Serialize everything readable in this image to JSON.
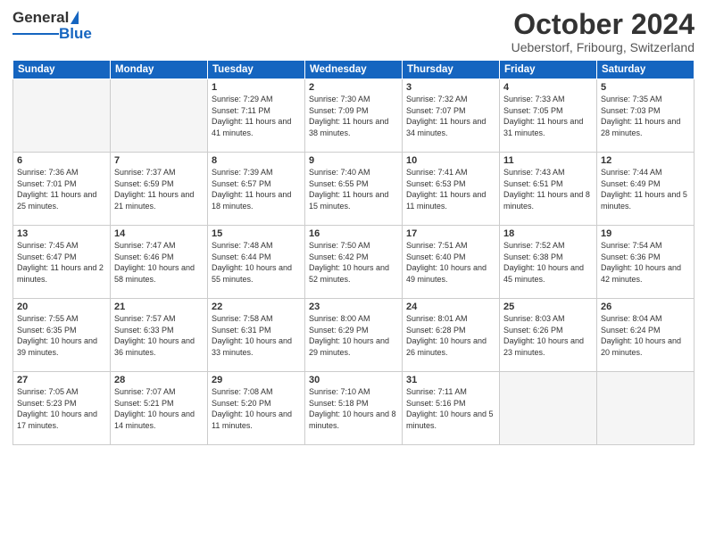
{
  "header": {
    "logo_general": "General",
    "logo_blue": "Blue",
    "main_title": "October 2024",
    "subtitle": "Ueberstorf, Fribourg, Switzerland"
  },
  "weekdays": [
    "Sunday",
    "Monday",
    "Tuesday",
    "Wednesday",
    "Thursday",
    "Friday",
    "Saturday"
  ],
  "weeks": [
    [
      {
        "day": "",
        "sunrise": "",
        "sunset": "",
        "daylight": "",
        "empty": true
      },
      {
        "day": "",
        "sunrise": "",
        "sunset": "",
        "daylight": "",
        "empty": true
      },
      {
        "day": "1",
        "sunrise": "Sunrise: 7:29 AM",
        "sunset": "Sunset: 7:11 PM",
        "daylight": "Daylight: 11 hours and 41 minutes.",
        "empty": false
      },
      {
        "day": "2",
        "sunrise": "Sunrise: 7:30 AM",
        "sunset": "Sunset: 7:09 PM",
        "daylight": "Daylight: 11 hours and 38 minutes.",
        "empty": false
      },
      {
        "day": "3",
        "sunrise": "Sunrise: 7:32 AM",
        "sunset": "Sunset: 7:07 PM",
        "daylight": "Daylight: 11 hours and 34 minutes.",
        "empty": false
      },
      {
        "day": "4",
        "sunrise": "Sunrise: 7:33 AM",
        "sunset": "Sunset: 7:05 PM",
        "daylight": "Daylight: 11 hours and 31 minutes.",
        "empty": false
      },
      {
        "day": "5",
        "sunrise": "Sunrise: 7:35 AM",
        "sunset": "Sunset: 7:03 PM",
        "daylight": "Daylight: 11 hours and 28 minutes.",
        "empty": false
      }
    ],
    [
      {
        "day": "6",
        "sunrise": "Sunrise: 7:36 AM",
        "sunset": "Sunset: 7:01 PM",
        "daylight": "Daylight: 11 hours and 25 minutes.",
        "empty": false
      },
      {
        "day": "7",
        "sunrise": "Sunrise: 7:37 AM",
        "sunset": "Sunset: 6:59 PM",
        "daylight": "Daylight: 11 hours and 21 minutes.",
        "empty": false
      },
      {
        "day": "8",
        "sunrise": "Sunrise: 7:39 AM",
        "sunset": "Sunset: 6:57 PM",
        "daylight": "Daylight: 11 hours and 18 minutes.",
        "empty": false
      },
      {
        "day": "9",
        "sunrise": "Sunrise: 7:40 AM",
        "sunset": "Sunset: 6:55 PM",
        "daylight": "Daylight: 11 hours and 15 minutes.",
        "empty": false
      },
      {
        "day": "10",
        "sunrise": "Sunrise: 7:41 AM",
        "sunset": "Sunset: 6:53 PM",
        "daylight": "Daylight: 11 hours and 11 minutes.",
        "empty": false
      },
      {
        "day": "11",
        "sunrise": "Sunrise: 7:43 AM",
        "sunset": "Sunset: 6:51 PM",
        "daylight": "Daylight: 11 hours and 8 minutes.",
        "empty": false
      },
      {
        "day": "12",
        "sunrise": "Sunrise: 7:44 AM",
        "sunset": "Sunset: 6:49 PM",
        "daylight": "Daylight: 11 hours and 5 minutes.",
        "empty": false
      }
    ],
    [
      {
        "day": "13",
        "sunrise": "Sunrise: 7:45 AM",
        "sunset": "Sunset: 6:47 PM",
        "daylight": "Daylight: 11 hours and 2 minutes.",
        "empty": false
      },
      {
        "day": "14",
        "sunrise": "Sunrise: 7:47 AM",
        "sunset": "Sunset: 6:46 PM",
        "daylight": "Daylight: 10 hours and 58 minutes.",
        "empty": false
      },
      {
        "day": "15",
        "sunrise": "Sunrise: 7:48 AM",
        "sunset": "Sunset: 6:44 PM",
        "daylight": "Daylight: 10 hours and 55 minutes.",
        "empty": false
      },
      {
        "day": "16",
        "sunrise": "Sunrise: 7:50 AM",
        "sunset": "Sunset: 6:42 PM",
        "daylight": "Daylight: 10 hours and 52 minutes.",
        "empty": false
      },
      {
        "day": "17",
        "sunrise": "Sunrise: 7:51 AM",
        "sunset": "Sunset: 6:40 PM",
        "daylight": "Daylight: 10 hours and 49 minutes.",
        "empty": false
      },
      {
        "day": "18",
        "sunrise": "Sunrise: 7:52 AM",
        "sunset": "Sunset: 6:38 PM",
        "daylight": "Daylight: 10 hours and 45 minutes.",
        "empty": false
      },
      {
        "day": "19",
        "sunrise": "Sunrise: 7:54 AM",
        "sunset": "Sunset: 6:36 PM",
        "daylight": "Daylight: 10 hours and 42 minutes.",
        "empty": false
      }
    ],
    [
      {
        "day": "20",
        "sunrise": "Sunrise: 7:55 AM",
        "sunset": "Sunset: 6:35 PM",
        "daylight": "Daylight: 10 hours and 39 minutes.",
        "empty": false
      },
      {
        "day": "21",
        "sunrise": "Sunrise: 7:57 AM",
        "sunset": "Sunset: 6:33 PM",
        "daylight": "Daylight: 10 hours and 36 minutes.",
        "empty": false
      },
      {
        "day": "22",
        "sunrise": "Sunrise: 7:58 AM",
        "sunset": "Sunset: 6:31 PM",
        "daylight": "Daylight: 10 hours and 33 minutes.",
        "empty": false
      },
      {
        "day": "23",
        "sunrise": "Sunrise: 8:00 AM",
        "sunset": "Sunset: 6:29 PM",
        "daylight": "Daylight: 10 hours and 29 minutes.",
        "empty": false
      },
      {
        "day": "24",
        "sunrise": "Sunrise: 8:01 AM",
        "sunset": "Sunset: 6:28 PM",
        "daylight": "Daylight: 10 hours and 26 minutes.",
        "empty": false
      },
      {
        "day": "25",
        "sunrise": "Sunrise: 8:03 AM",
        "sunset": "Sunset: 6:26 PM",
        "daylight": "Daylight: 10 hours and 23 minutes.",
        "empty": false
      },
      {
        "day": "26",
        "sunrise": "Sunrise: 8:04 AM",
        "sunset": "Sunset: 6:24 PM",
        "daylight": "Daylight: 10 hours and 20 minutes.",
        "empty": false
      }
    ],
    [
      {
        "day": "27",
        "sunrise": "Sunrise: 7:05 AM",
        "sunset": "Sunset: 5:23 PM",
        "daylight": "Daylight: 10 hours and 17 minutes.",
        "empty": false
      },
      {
        "day": "28",
        "sunrise": "Sunrise: 7:07 AM",
        "sunset": "Sunset: 5:21 PM",
        "daylight": "Daylight: 10 hours and 14 minutes.",
        "empty": false
      },
      {
        "day": "29",
        "sunrise": "Sunrise: 7:08 AM",
        "sunset": "Sunset: 5:20 PM",
        "daylight": "Daylight: 10 hours and 11 minutes.",
        "empty": false
      },
      {
        "day": "30",
        "sunrise": "Sunrise: 7:10 AM",
        "sunset": "Sunset: 5:18 PM",
        "daylight": "Daylight: 10 hours and 8 minutes.",
        "empty": false
      },
      {
        "day": "31",
        "sunrise": "Sunrise: 7:11 AM",
        "sunset": "Sunset: 5:16 PM",
        "daylight": "Daylight: 10 hours and 5 minutes.",
        "empty": false
      },
      {
        "day": "",
        "sunrise": "",
        "sunset": "",
        "daylight": "",
        "empty": true
      },
      {
        "day": "",
        "sunrise": "",
        "sunset": "",
        "daylight": "",
        "empty": true
      }
    ]
  ]
}
